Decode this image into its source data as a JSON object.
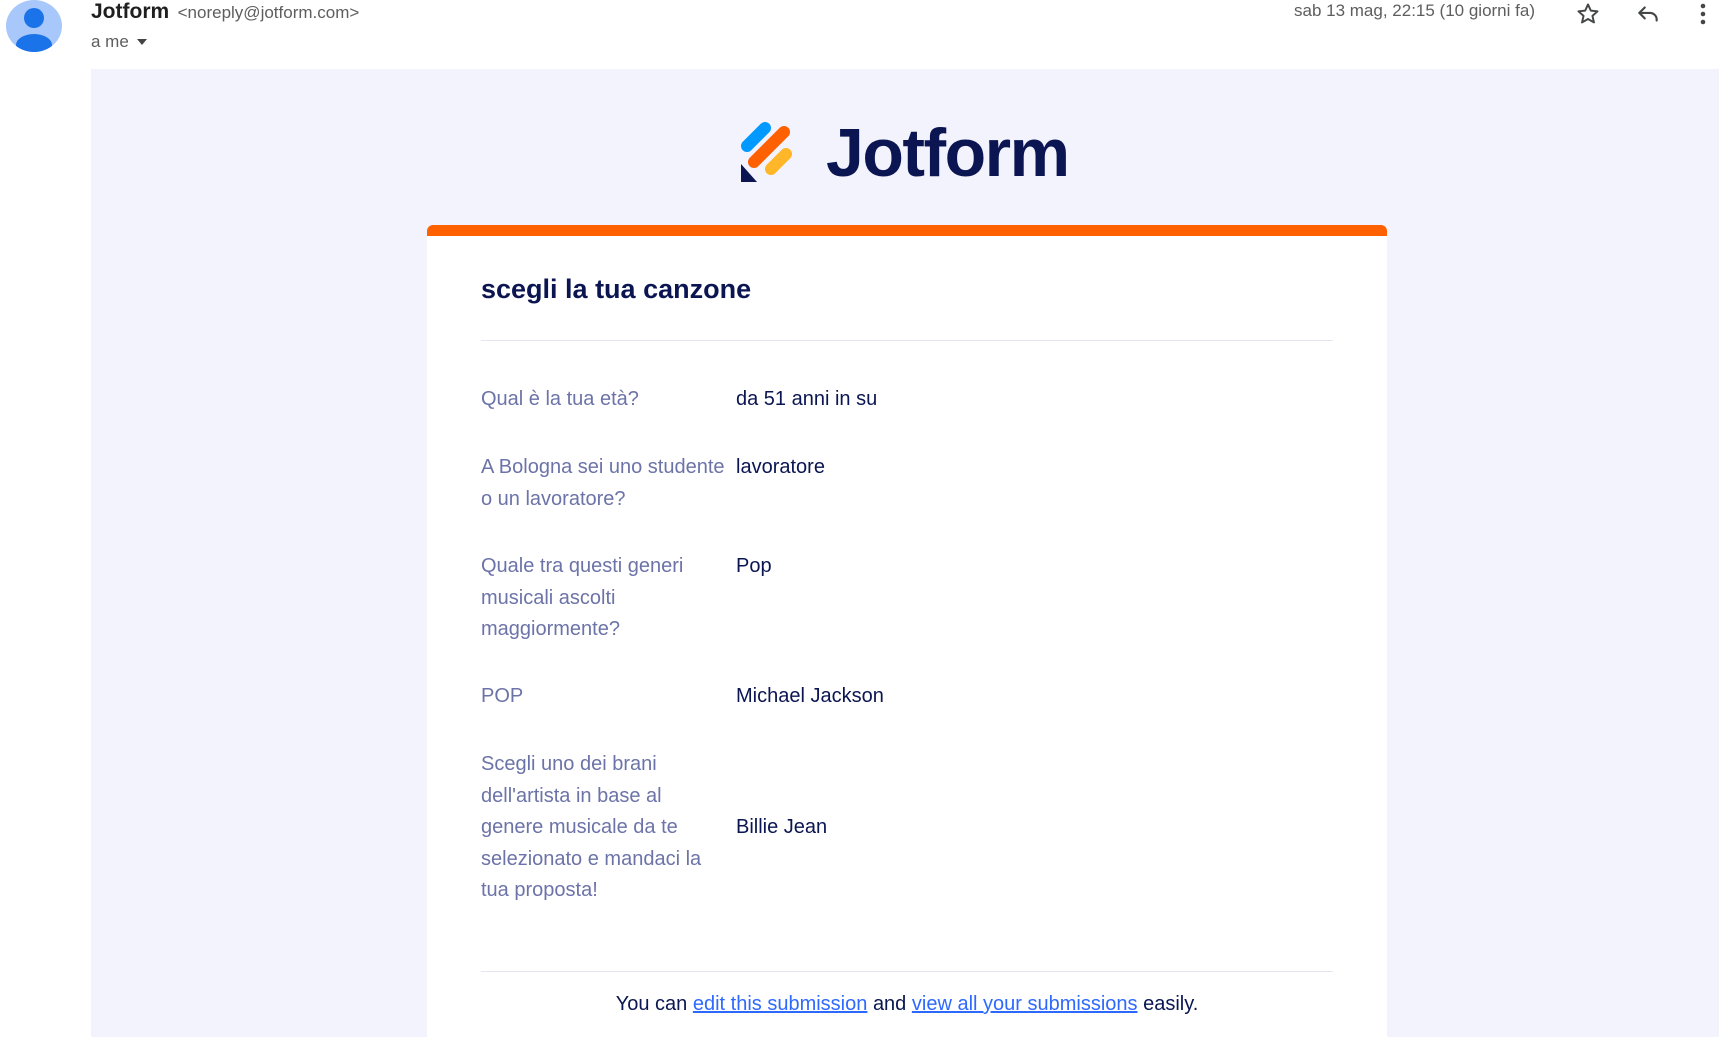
{
  "header": {
    "sender_name": "Jotform",
    "sender_email": "<noreply@jotform.com>",
    "to_label": "a me",
    "date": "sab 13 mag, 22:15 (10 giorni fa)",
    "icons": [
      "star-icon",
      "reply-icon",
      "more-vert-icon"
    ]
  },
  "email": {
    "brand": "Jotform",
    "brand_colors": {
      "navy": "#0a1551",
      "orange": "#ff6100",
      "blue": "#0099ff",
      "yellow": "#ffb629"
    },
    "form_title": "scegli la tua canzone",
    "rows": [
      {
        "question": "Qual è la tua età?",
        "answer": "da 51 anni in su"
      },
      {
        "question": "A Bologna sei uno studente o un lavoratore?",
        "answer": "lavoratore"
      },
      {
        "question": "Quale tra questi generi musicali ascolti maggiormente?",
        "answer": "Pop"
      },
      {
        "question": "POP",
        "answer": "Michael Jackson"
      },
      {
        "question": "Scegli uno dei brani dell'artista in base al genere musicale da te selezionato e mandaci la tua proposta!",
        "answer": "Billie Jean"
      }
    ],
    "footer": {
      "prefix": "You can",
      "edit_link": "edit this submission",
      "middle": "and",
      "view_link": "view all your submissions",
      "suffix": "easily."
    }
  }
}
